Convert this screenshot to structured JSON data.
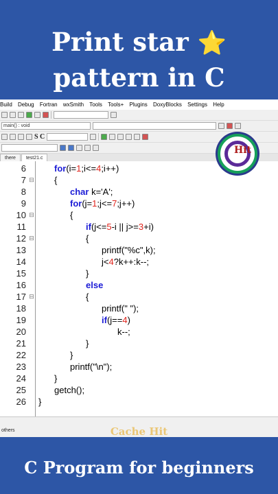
{
  "title": {
    "line1": "Print star",
    "star_icon": "⭐",
    "line2": "pattern in C"
  },
  "menu": [
    "Build",
    "Debug",
    "Fortran",
    "wxSmith",
    "Tools",
    "Tools+",
    "Plugins",
    "DoxyBlocks",
    "Settings",
    "Help"
  ],
  "toolbar": {
    "scope_select": "main() : void",
    "sc_label": "S C"
  },
  "tabs": [
    "there",
    "test21.c"
  ],
  "code": [
    {
      "n": "6",
      "fold": "",
      "html": "for(i=1;i<=4;i++)"
    },
    {
      "n": "7",
      "fold": "⊟",
      "html": "{"
    },
    {
      "n": "8",
      "fold": "",
      "html": "char k='A';"
    },
    {
      "n": "9",
      "fold": "",
      "html": "for(j=1;j<=7;j++)"
    },
    {
      "n": "10",
      "fold": "⊟",
      "html": "{"
    },
    {
      "n": "11",
      "fold": "",
      "html": "if(j<=5-i || j>=3+i)"
    },
    {
      "n": "12",
      "fold": "⊟",
      "html": "{"
    },
    {
      "n": "13",
      "fold": "",
      "html": "printf(\"%c\",k);"
    },
    {
      "n": "14",
      "fold": "",
      "html": "j<4?k++:k--;"
    },
    {
      "n": "15",
      "fold": "",
      "html": "}"
    },
    {
      "n": "16",
      "fold": "",
      "html": "else"
    },
    {
      "n": "17",
      "fold": "⊟",
      "html": "{"
    },
    {
      "n": "18",
      "fold": "",
      "html": "printf(\" \");"
    },
    {
      "n": "19",
      "fold": "",
      "html": "if(j==4)"
    },
    {
      "n": "20",
      "fold": "",
      "html": "k--;"
    },
    {
      "n": "21",
      "fold": "",
      "html": "}"
    },
    {
      "n": "22",
      "fold": "",
      "html": "}"
    },
    {
      "n": "23",
      "fold": "",
      "html": "printf(\"\\n\");"
    },
    {
      "n": "24",
      "fold": "",
      "html": "}"
    },
    {
      "n": "25",
      "fold": "",
      "html": "getch();"
    },
    {
      "n": "26",
      "fold": "",
      "html": "}"
    }
  ],
  "logo": {
    "text": "Hit"
  },
  "status": {
    "tab": "others",
    "watermark": "Cache Hit"
  },
  "footer": {
    "text": "C Program for beginners"
  },
  "colors": {
    "banner": "#2d56a6",
    "keyword": "#1c1cd6",
    "number": "#e0241c"
  }
}
